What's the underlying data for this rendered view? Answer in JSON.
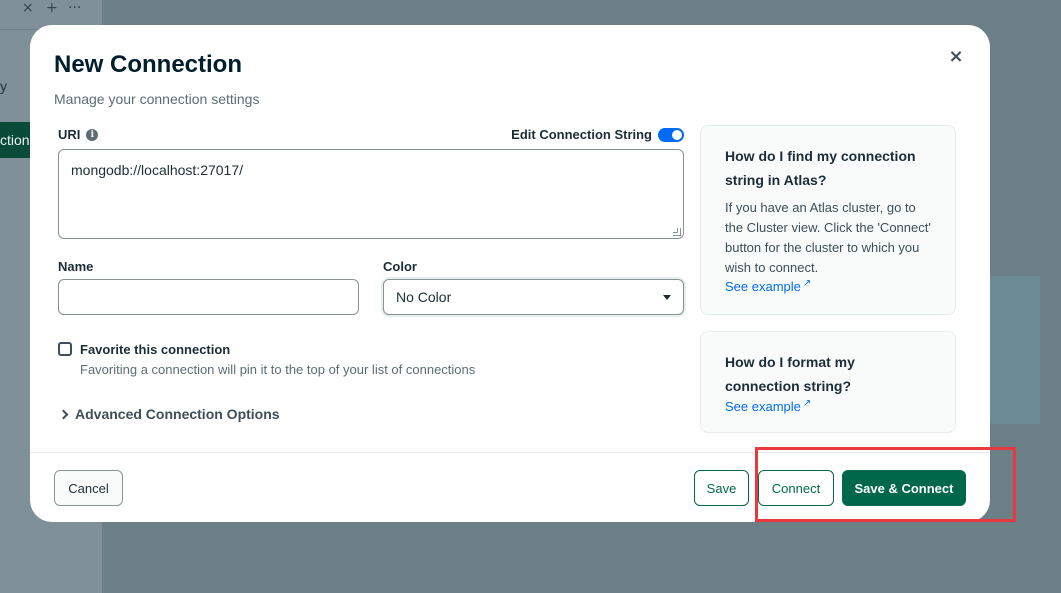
{
  "background": {
    "tab_icons": [
      "×",
      "+",
      "···"
    ],
    "sidebar_item_1": "y",
    "sidebar_item_2": "ction"
  },
  "modal": {
    "title": "New Connection",
    "subtitle": "Manage your connection settings",
    "close_icon": "×",
    "uri": {
      "label": "URI",
      "value": "mongodb://localhost:27017/"
    },
    "edit_connection_string": {
      "label": "Edit Connection String",
      "enabled": true
    },
    "name": {
      "label": "Name",
      "value": ""
    },
    "color": {
      "label": "Color",
      "selected": "No Color"
    },
    "favorite": {
      "label": "Favorite this connection",
      "description": "Favoriting a connection will pin it to the top of your list of connections",
      "checked": false
    },
    "advanced": {
      "label": "Advanced Connection Options"
    },
    "help": [
      {
        "title": "How do I find my connection string in Atlas?",
        "body": "If you have an Atlas cluster, go to the Cluster view. Click the 'Connect' button for the cluster to which you wish to connect.",
        "link": "See example"
      },
      {
        "title": "How do I format my connection string?",
        "body": "",
        "link": "See example"
      }
    ],
    "footer": {
      "cancel": "Cancel",
      "save": "Save",
      "connect": "Connect",
      "save_connect": "Save & Connect"
    }
  },
  "colors": {
    "primary_green": "#00684a",
    "link_blue": "#016bf8",
    "highlight_red": "#e8393f",
    "overlay": "#6b7f86"
  }
}
